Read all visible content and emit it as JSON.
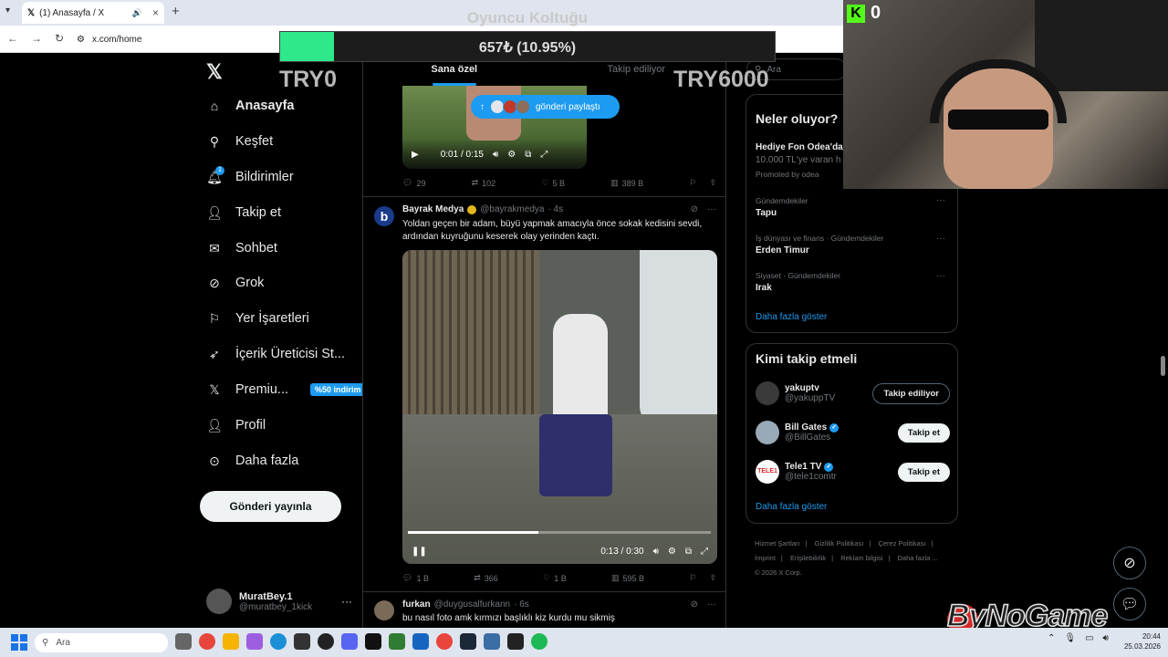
{
  "browser": {
    "tab_title": "(1) Anasayfa / X",
    "url": "x.com/home"
  },
  "overlay": {
    "title": "Oyuncu Koltuğu",
    "progress_text": "657₺ (10.95%)",
    "progress_fraction": 0.1095,
    "left_label": "TRY0",
    "right_label": "TRY6000",
    "bar_color": "#2ee88a"
  },
  "kick": {
    "viewers": "0",
    "accent": "#53fc18"
  },
  "sidebar": {
    "items": [
      {
        "label": "Anasayfa",
        "icon": "home-icon"
      },
      {
        "label": "Keşfet",
        "icon": "search-icon"
      },
      {
        "label": "Bildirimler",
        "icon": "bell-icon",
        "badge": "1"
      },
      {
        "label": "Takip et",
        "icon": "person-add-icon"
      },
      {
        "label": "Sohbet",
        "icon": "mail-icon"
      },
      {
        "label": "Grok",
        "icon": "grok-icon"
      },
      {
        "label": "Yer İşaretleri",
        "icon": "bookmark-icon"
      },
      {
        "label": "İçerik Üreticisi St...",
        "icon": "rocket-icon"
      },
      {
        "label": "Premiu...",
        "icon": "x-icon",
        "promo": "%50 indirim"
      },
      {
        "label": "Profil",
        "icon": "profile-icon"
      },
      {
        "label": "Daha fazla",
        "icon": "more-circle-icon"
      }
    ],
    "post_button": "Gönderi yayınla",
    "account": {
      "name": "MuratBey.1",
      "handle": "@muratbey_1kick"
    }
  },
  "feed": {
    "tabs": [
      "Sana özel",
      "Takip ediliyor"
    ],
    "share_pill": "gönderi paylaştı",
    "post1": {
      "video_time": "0:01 / 0:15",
      "replies": "29",
      "reposts": "102",
      "likes": "5 B",
      "views": "389 B"
    },
    "post2": {
      "name": "Bayrak Medya",
      "handle": "@bayrakmedya",
      "time": "· 4s",
      "text": "Yoldan geçen bir adam, büyü yapmak amacıyla önce sokak kedisini sevdi, ardından kuyruğunu keserek olay yerinden kaçtı.",
      "video_time": "0:13 / 0:30",
      "video_progress": 0.43,
      "replies": "1 B",
      "reposts": "366",
      "likes": "1 B",
      "views": "595 B"
    },
    "post3": {
      "name": "furkan",
      "handle": "@duygusalfurkann",
      "time": "· 6s",
      "text": "bu nasıl foto amk kırmızı başlıklı kiz kurdu mu sikmiş"
    }
  },
  "right": {
    "search_placeholder": "Ara",
    "trends_title": "Neler oluyor?",
    "trends": [
      {
        "meta": "",
        "name": "Hediye Fon Odea'da",
        "sub": "10.000 TL'ye varan h",
        "promo": "Promoted by odea"
      },
      {
        "meta": "Gündemdekiler",
        "name": "Tapu"
      },
      {
        "meta": "İş dünyası ve finans · Gündemdekiler",
        "name": "Erden Timur"
      },
      {
        "meta": "Siyaset · Gündemdekiler",
        "name": "Irak"
      }
    ],
    "show_more": "Daha fazla göster",
    "who_title": "Kimi takip etmeli",
    "who": [
      {
        "name": "yakuptv",
        "handle": "@yakuppTV",
        "button": "Takip ediliyor",
        "verified": false
      },
      {
        "name": "Bill Gates",
        "handle": "@BillGates",
        "button": "Takip et",
        "verified": true
      },
      {
        "name": "Tele1 TV",
        "handle": "@tele1comtr",
        "button": "Takip et",
        "verified": true
      }
    ],
    "footer_links": [
      "Hizmet Şartları",
      "|",
      "Gizlilik Politikası",
      "|",
      "Çerez Politikası",
      "|",
      "İmprint",
      "|",
      "Erişilebilirlik",
      "|",
      "Reklam bilgisi",
      "|",
      "Daha fazla ...",
      "© 2026 X Corp."
    ]
  },
  "brand": {
    "text": "ByNoGame"
  },
  "taskbar": {
    "search_placeholder": "Ara",
    "time": "20:44",
    "date": "25.03.2026"
  }
}
